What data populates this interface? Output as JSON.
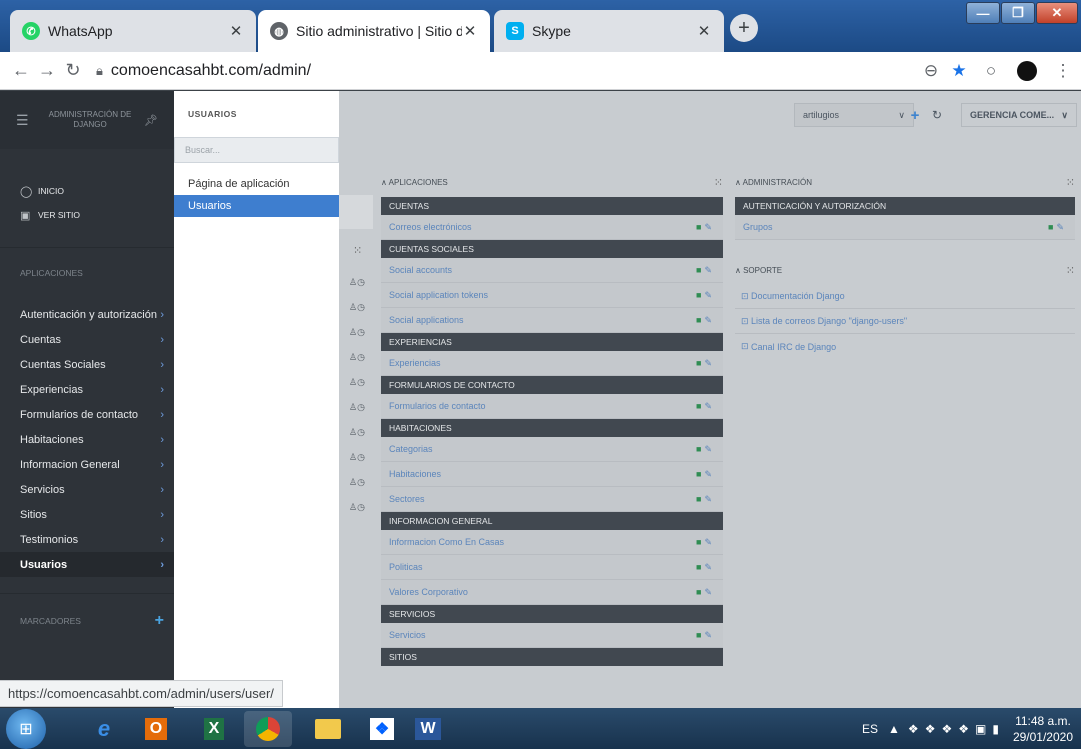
{
  "browser": {
    "tabs": [
      {
        "title": "WhatsApp",
        "icon": "whatsapp-icon",
        "color": "#25d366"
      },
      {
        "title": "Sitio administrativo | Sitio de adm",
        "icon": "globe-icon",
        "color": "#5f6368"
      },
      {
        "title": "Skype",
        "icon": "skype-icon",
        "color": "#00aff0"
      }
    ],
    "url": "comoencasahbt.com/admin/",
    "status_url": "https://comoencasahbt.com/admin/users/user/"
  },
  "sidebar": {
    "title_line1": "ADMINISTRACIÓN DE",
    "title_line2": "DJANGO",
    "links": [
      {
        "label": "INICIO"
      },
      {
        "label": "VER SITIO"
      }
    ],
    "section_apps": "APLICACIONES",
    "items": [
      {
        "label": "Autenticación y autorización"
      },
      {
        "label": "Cuentas"
      },
      {
        "label": "Cuentas Sociales"
      },
      {
        "label": "Experiencias"
      },
      {
        "label": "Formularios de contacto"
      },
      {
        "label": "Habitaciones"
      },
      {
        "label": "Informacion General"
      },
      {
        "label": "Servicios"
      },
      {
        "label": "Sitios"
      },
      {
        "label": "Testimonios"
      },
      {
        "label": "Usuarios"
      }
    ],
    "section_bookmarks": "MARCADORES"
  },
  "submenu": {
    "title": "USUARIOS",
    "search_placeholder": "Buscar...",
    "items": [
      {
        "label": "Página de aplicación"
      },
      {
        "label": "Usuarios"
      }
    ]
  },
  "topbar": {
    "dropdown_value": "artilugios",
    "user_menu": "GERENCIA COME..."
  },
  "apps_column": {
    "title": "APLICACIONES",
    "modules": [
      {
        "name": "CUENTAS",
        "rows": [
          "Correos electrónicos"
        ]
      },
      {
        "name": "CUENTAS SOCIALES",
        "rows": [
          "Social accounts",
          "Social application tokens",
          "Social applications"
        ]
      },
      {
        "name": "EXPERIENCIAS",
        "rows": [
          "Experiencias"
        ]
      },
      {
        "name": "FORMULARIOS DE CONTACTO",
        "rows": [
          "Formularios de contacto"
        ]
      },
      {
        "name": "HABITACIONES",
        "rows": [
          "Categorias",
          "Habitaciones",
          "Sectores"
        ]
      },
      {
        "name": "INFORMACION GENERAL",
        "rows": [
          "Informacion Como En Casas",
          "Politicas",
          "Valores Corporativo"
        ]
      },
      {
        "name": "SERVICIOS",
        "rows": [
          "Servicios"
        ]
      },
      {
        "name": "SITIOS",
        "rows": []
      }
    ]
  },
  "admin_column": {
    "title": "ADMINISTRACIÓN",
    "module": "AUTENTICACIÓN Y AUTORIZACIÓN",
    "rows": [
      "Grupos"
    ]
  },
  "support_column": {
    "title": "SOPORTE",
    "links": [
      "Documentación Django",
      "Lista de correos Django \"django-users\"",
      "Canal IRC de Django"
    ]
  },
  "taskbar": {
    "lang": "ES",
    "time": "11:48 a.m.",
    "date": "29/01/2020"
  }
}
